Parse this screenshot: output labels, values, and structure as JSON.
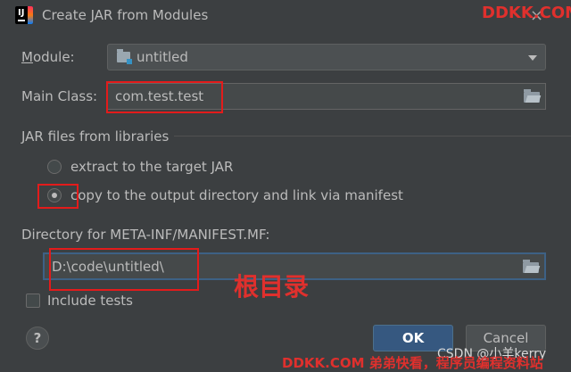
{
  "window": {
    "title": "Create JAR from Modules",
    "close_glyph": "×",
    "app_icon": "intellij-idea-icon",
    "app_icon_text": "IJ"
  },
  "watermarks": {
    "top": "DDKK.COM",
    "csdn": "CSDN @小羊kerry",
    "bottom": "DDKK.COM 弟弟快看，程序员编程资料站"
  },
  "module": {
    "label": "Module:",
    "value": "untitled",
    "icon": "module-folder-icon"
  },
  "main_class": {
    "label": "Main Class:",
    "value": "com.test.test",
    "browse_icon": "folder-open-icon"
  },
  "jar_files": {
    "section_label": "JAR files from libraries",
    "options": [
      {
        "label": "extract to the target JAR",
        "selected": false
      },
      {
        "label": "copy to the output directory and link via manifest",
        "selected": true
      }
    ]
  },
  "manifest_dir": {
    "label": "Directory for META-INF/MANIFEST.MF:",
    "value": "D:\\code\\untitled\\",
    "browse_icon": "folder-open-icon"
  },
  "annotation": "根目录",
  "include_tests": {
    "label": "Include tests",
    "checked": false
  },
  "footer": {
    "help_glyph": "?",
    "ok_label": "OK",
    "cancel_label": "Cancel"
  },
  "colors": {
    "background": "#3c3f41",
    "text": "#bbbbbb",
    "primary_button": "#365880",
    "annotation_red": "#e31b1b",
    "focus_border": "#3d6185"
  }
}
